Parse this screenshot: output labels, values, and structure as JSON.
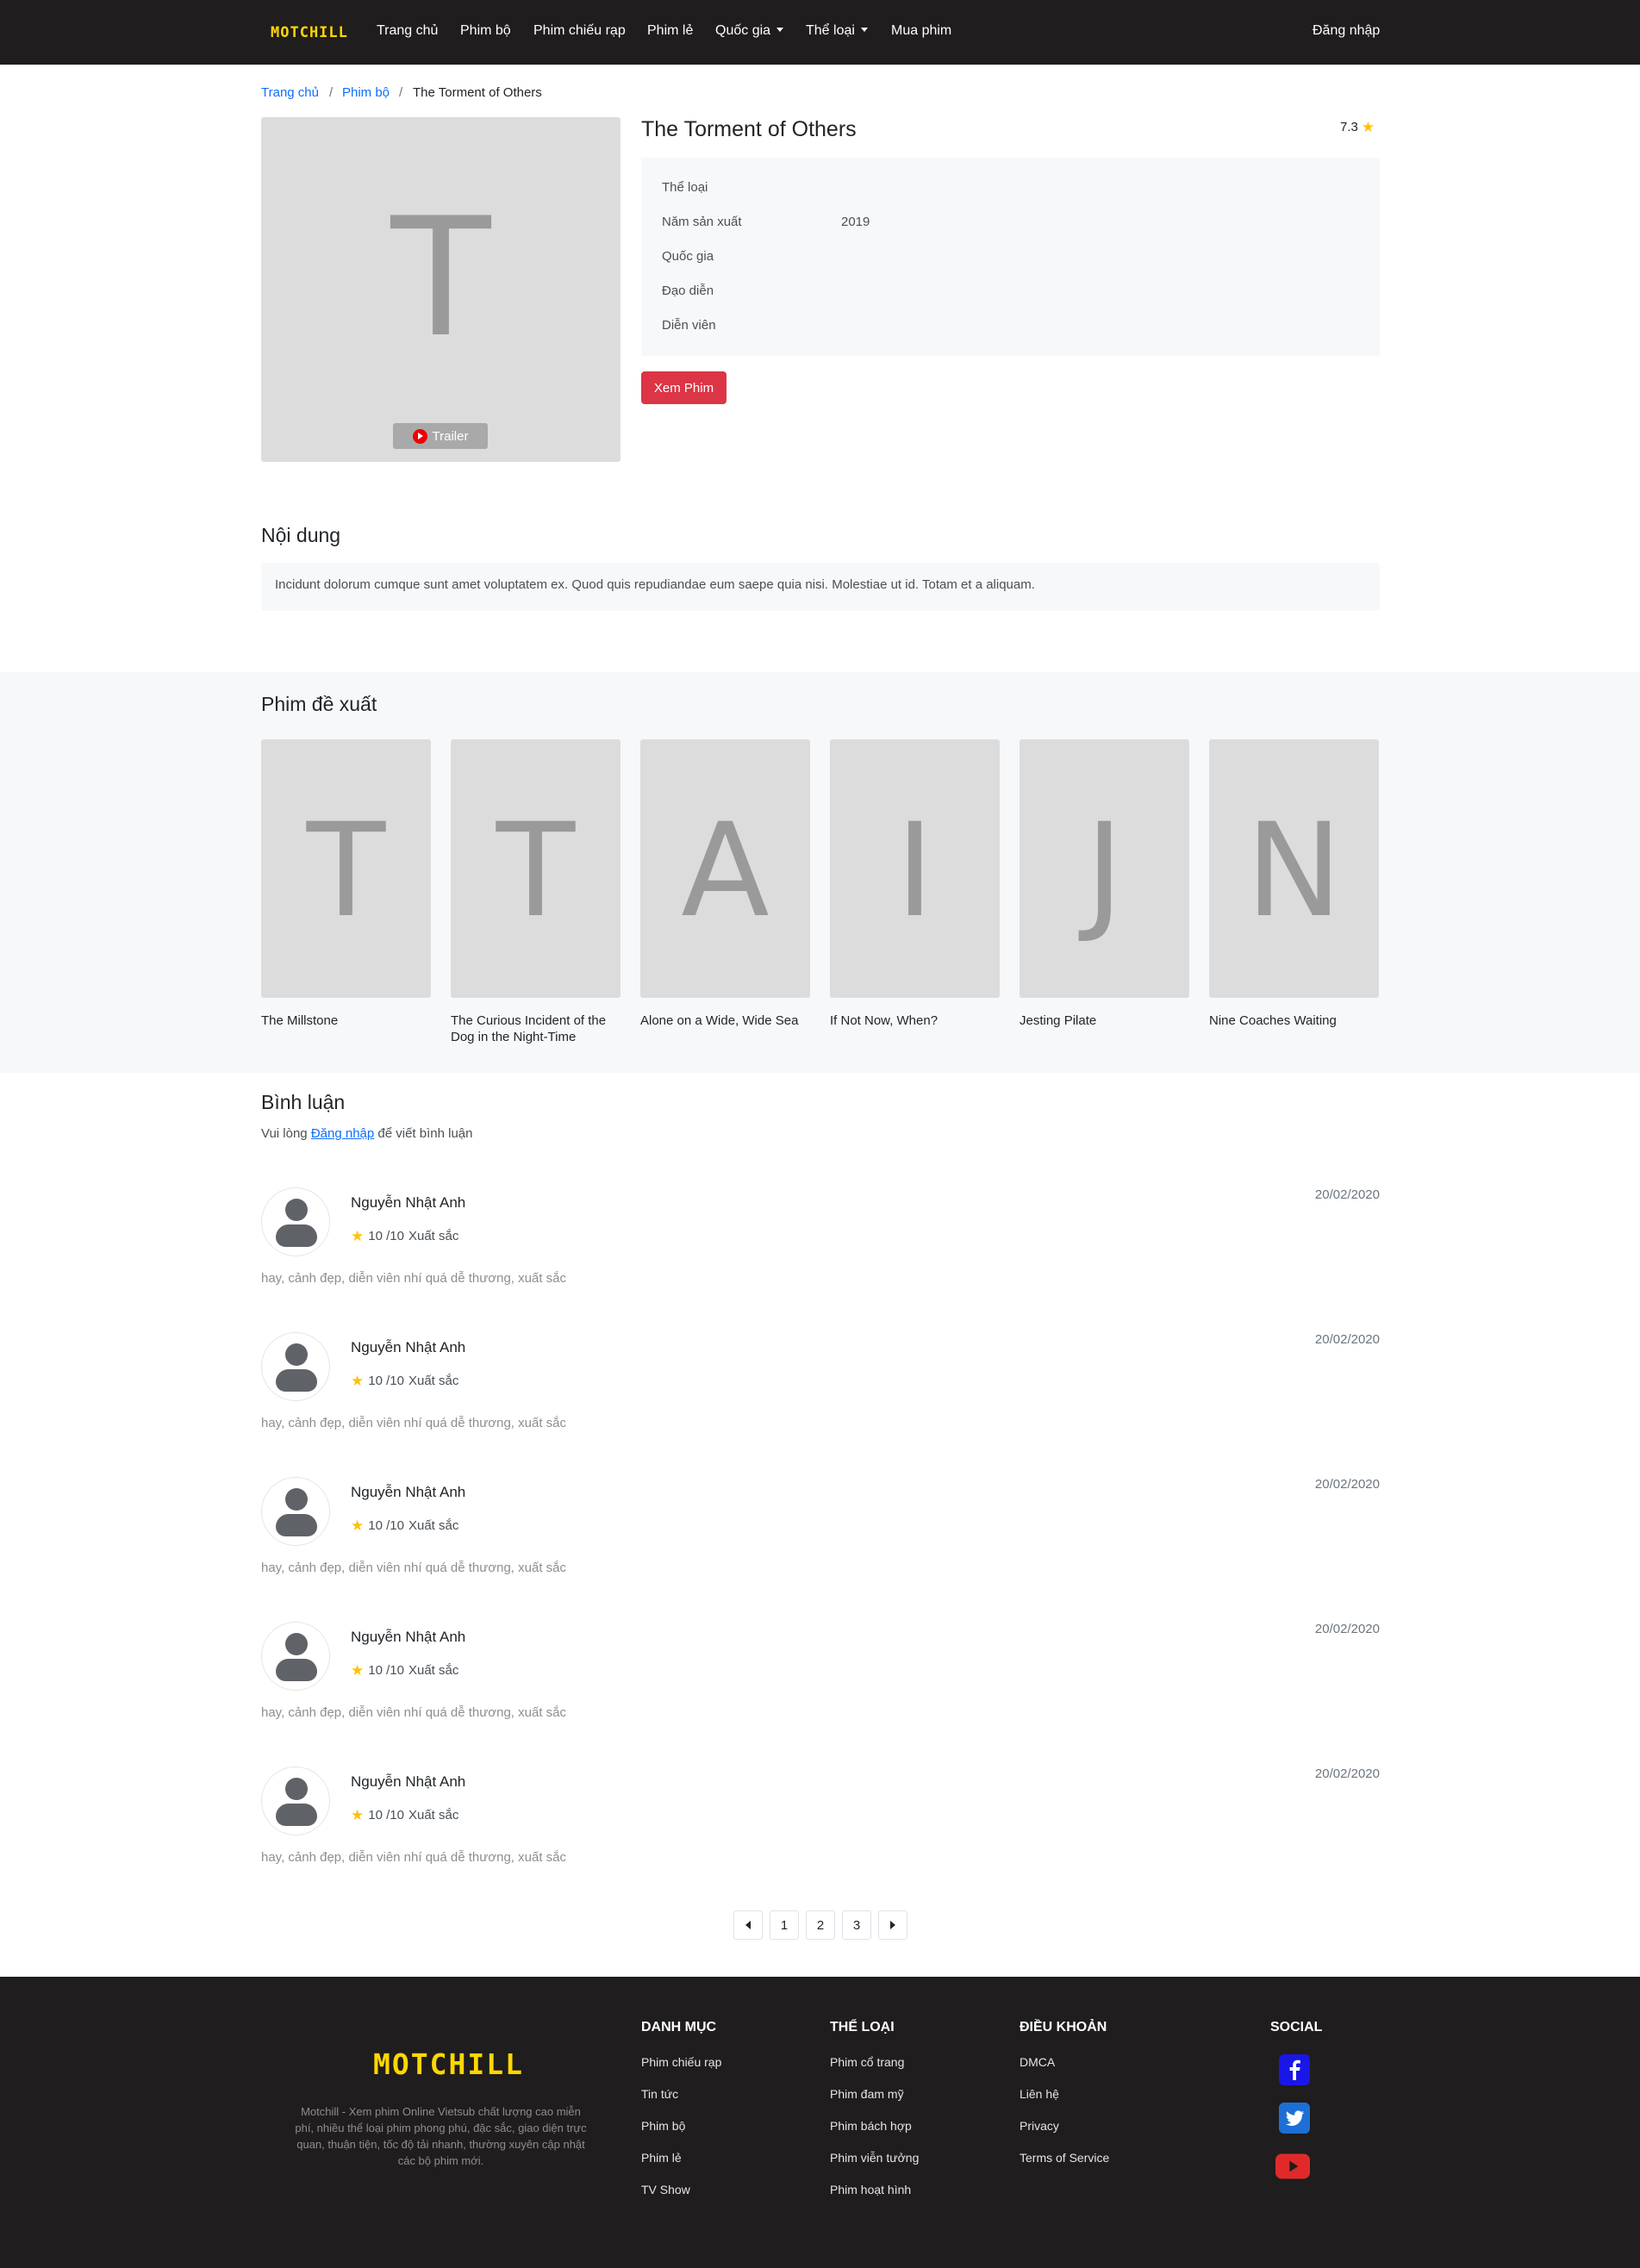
{
  "nav": {
    "logo": "MOTCHILL",
    "items": [
      "Trang chủ",
      "Phim bộ",
      "Phim chiếu rạp",
      "Phim lẻ",
      "Quốc gia",
      "Thể loại",
      "Mua phim"
    ],
    "login": "Đăng nhập"
  },
  "breadcrumb": {
    "home": "Trang chủ",
    "category": "Phim bộ",
    "current": "The Torment of Others",
    "separator": "/"
  },
  "movie": {
    "poster_letter": "T",
    "trailer_label": "Trailer",
    "title": "The Torment of Others",
    "rating": "7.3",
    "info": [
      {
        "label": "Thể loại",
        "value": ""
      },
      {
        "label": "Năm sản xuất",
        "value": "2019"
      },
      {
        "label": "Quốc gia",
        "value": ""
      },
      {
        "label": "Đạo diễn",
        "value": ""
      },
      {
        "label": "Diễn viên",
        "value": ""
      }
    ],
    "watch_label": "Xem Phim"
  },
  "content": {
    "heading": "Nội dung",
    "text": "Incidunt dolorum cumque sunt amet voluptatem ex. Quod quis repudiandae eum saepe quia nisi. Molestiae ut id. Totam et a aliquam."
  },
  "recommended": {
    "heading": "Phim đề xuất",
    "items": [
      {
        "letter": "T",
        "title": "The Millstone"
      },
      {
        "letter": "T",
        "title": "The Curious Incident of the Dog in the Night-Time"
      },
      {
        "letter": "A",
        "title": "Alone on a Wide, Wide Sea"
      },
      {
        "letter": "I",
        "title": "If Not Now, When?"
      },
      {
        "letter": "J",
        "title": "Jesting Pilate"
      },
      {
        "letter": "N",
        "title": "Nine Coaches Waiting"
      }
    ]
  },
  "comments": {
    "heading": "Bình luận",
    "note_before": "Vui lòng",
    "note_link": "Đăng nhập",
    "note_after": "để viết bình luận",
    "items": [
      {
        "name": "Nguyễn Nhật Anh",
        "score": "10 /10",
        "verdict": "Xuất sắc",
        "date": "20/02/2020",
        "text": "hay, cảnh đẹp, diễn viên nhí quá dễ thương, xuất sắc"
      },
      {
        "name": "Nguyễn Nhật Anh",
        "score": "10 /10",
        "verdict": "Xuất sắc",
        "date": "20/02/2020",
        "text": "hay, cảnh đẹp, diễn viên nhí quá dễ thương, xuất sắc"
      },
      {
        "name": "Nguyễn Nhật Anh",
        "score": "10 /10",
        "verdict": "Xuất sắc",
        "date": "20/02/2020",
        "text": "hay, cảnh đẹp, diễn viên nhí quá dễ thương, xuất sắc"
      },
      {
        "name": "Nguyễn Nhật Anh",
        "score": "10 /10",
        "verdict": "Xuất sắc",
        "date": "20/02/2020",
        "text": "hay, cảnh đẹp, diễn viên nhí quá dễ thương, xuất sắc"
      },
      {
        "name": "Nguyễn Nhật Anh",
        "score": "10 /10",
        "verdict": "Xuất sắc",
        "date": "20/02/2020",
        "text": "hay, cảnh đẹp, diễn viên nhí quá dễ thương, xuất sắc"
      }
    ]
  },
  "pagination": {
    "pages": [
      "1",
      "2",
      "3"
    ]
  },
  "footer": {
    "logo": "MOTCHILL",
    "description": "Motchill - Xem phim Online Vietsub chất lượng cao miễn phí, nhiều thể loại phim phong phú, đặc sắc, giao diện trực quan, thuận tiện, tốc độ tải nhanh, thường xuyên cập nhật các bộ phim mới.",
    "columns": [
      {
        "heading": "DANH MỤC",
        "links": [
          "Phim chiếu rạp",
          "Tin tức",
          "Phim bộ",
          "Phim lẻ",
          "TV Show"
        ]
      },
      {
        "heading": "THỂ LOẠI",
        "links": [
          "Phim cổ trang",
          "Phim đam mỹ",
          "Phim bách hợp",
          "Phim viễn tưởng",
          "Phim hoạt hình"
        ]
      },
      {
        "heading": "ĐIỀU KHOẢN",
        "links": [
          "DMCA",
          "Liên hệ",
          "Privacy",
          "Terms of Service"
        ]
      }
    ],
    "social_heading": "SOCIAL",
    "social": [
      "facebook-icon",
      "twitter-icon",
      "youtube-icon"
    ]
  },
  "colors": {
    "navbar_bg": "#1f1d1d",
    "logo": "#ffd700",
    "link": "#0d6efd",
    "watch_button": "#dc3545",
    "star": "#ffc107",
    "facebook": "#1a16e8",
    "twitter": "#1d6fd6",
    "youtube": "#e02a2a"
  }
}
